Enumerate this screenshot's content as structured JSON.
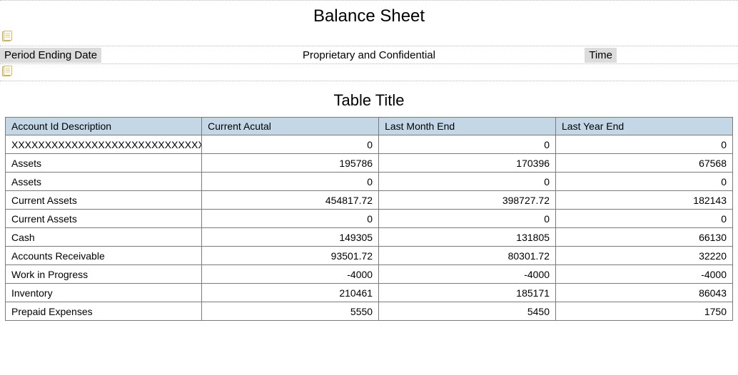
{
  "report_title": "Balance Sheet",
  "meta": {
    "period_label": "Period Ending Date",
    "confidential": "Proprietary and Confidential",
    "time_label": "Time"
  },
  "table_title": "Table Title",
  "columns": [
    "Account Id Description",
    "Current Acutal",
    "Last Month End",
    "Last Year End"
  ],
  "rows": [
    {
      "desc": "XXXXXXXXXXXXXXXXXXXXXXXXXXXXXX",
      "current": "0",
      "last_month": "0",
      "last_year": "0"
    },
    {
      "desc": "Assets",
      "current": "195786",
      "last_month": "170396",
      "last_year": "67568"
    },
    {
      "desc": "Assets",
      "current": "0",
      "last_month": "0",
      "last_year": "0"
    },
    {
      "desc": "Current Assets",
      "current": "454817.72",
      "last_month": "398727.72",
      "last_year": "182143"
    },
    {
      "desc": "Current Assets",
      "current": "0",
      "last_month": "0",
      "last_year": "0"
    },
    {
      "desc": "Cash",
      "current": "149305",
      "last_month": "131805",
      "last_year": "66130"
    },
    {
      "desc": "Accounts Receivable",
      "current": "93501.72",
      "last_month": "80301.72",
      "last_year": "32220"
    },
    {
      "desc": "Work in Progress",
      "current": "-4000",
      "last_month": "-4000",
      "last_year": "-4000"
    },
    {
      "desc": "Inventory",
      "current": "210461",
      "last_month": "185171",
      "last_year": "86043"
    },
    {
      "desc": "Prepaid Expenses",
      "current": "5550",
      "last_month": "5450",
      "last_year": "1750"
    }
  ],
  "chart_data": {
    "type": "table",
    "title": "Balance Sheet — Table Title",
    "columns": [
      "Account Id Description",
      "Current Acutal",
      "Last Month End",
      "Last Year End"
    ],
    "rows": [
      [
        "XXXXXXXXXXXXXXXXXXXXXXXXXXXXXX",
        0,
        0,
        0
      ],
      [
        "Assets",
        195786,
        170396,
        67568
      ],
      [
        "Assets",
        0,
        0,
        0
      ],
      [
        "Current Assets",
        454817.72,
        398727.72,
        182143
      ],
      [
        "Current Assets",
        0,
        0,
        0
      ],
      [
        "Cash",
        149305,
        131805,
        66130
      ],
      [
        "Accounts Receivable",
        93501.72,
        80301.72,
        32220
      ],
      [
        "Work in Progress",
        -4000,
        -4000,
        -4000
      ],
      [
        "Inventory",
        210461,
        185171,
        86043
      ],
      [
        "Prepaid Expenses",
        5550,
        5450,
        1750
      ]
    ]
  }
}
